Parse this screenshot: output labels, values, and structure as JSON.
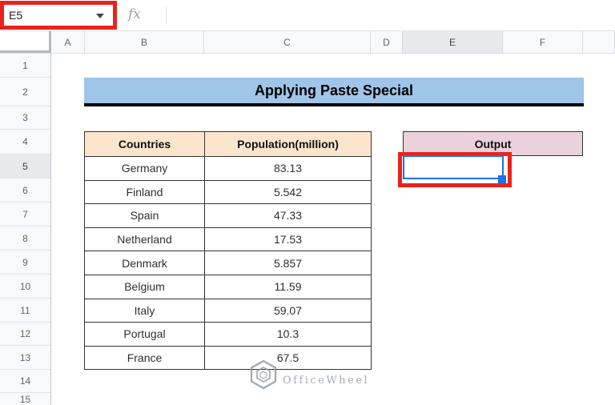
{
  "name_box": {
    "value": "E5"
  },
  "formula_bar": {
    "fx_label": "fx"
  },
  "column_headers": [
    "A",
    "B",
    "C",
    "D",
    "E",
    "F"
  ],
  "row_headers": [
    "1",
    "2",
    "3",
    "4",
    "5",
    "6",
    "7",
    "8",
    "9",
    "10",
    "11",
    "12",
    "13",
    "14",
    "15"
  ],
  "title": {
    "text": "Applying Paste Special"
  },
  "table": {
    "headers": {
      "country": "Countries",
      "population": "Population(million)"
    },
    "rows": [
      {
        "country": "Germany",
        "population": "83.13"
      },
      {
        "country": "Finland",
        "population": "5.542"
      },
      {
        "country": "Spain",
        "population": "47.33"
      },
      {
        "country": "Netherland",
        "population": "17.53"
      },
      {
        "country": "Denmark",
        "population": "5.857"
      },
      {
        "country": "Belgium",
        "population": "11.59"
      },
      {
        "country": "Italy",
        "population": "59.07"
      },
      {
        "country": "Portugal",
        "population": "10.3"
      },
      {
        "country": "France",
        "population": "67.5"
      }
    ]
  },
  "output": {
    "label": "Output"
  },
  "selection": {
    "cell_ref": "E5"
  },
  "watermark": {
    "text": "OfficeWheel"
  },
  "colors": {
    "title_bg": "#9fc5e8",
    "table_header_bg": "#fce5cd",
    "output_bg": "#ead1dc",
    "selection_blue": "#1a73e8",
    "annotation_red": "#e8231d",
    "header_strip_bg": "#f8f9fa",
    "active_header_bg": "#e7e9ec"
  }
}
